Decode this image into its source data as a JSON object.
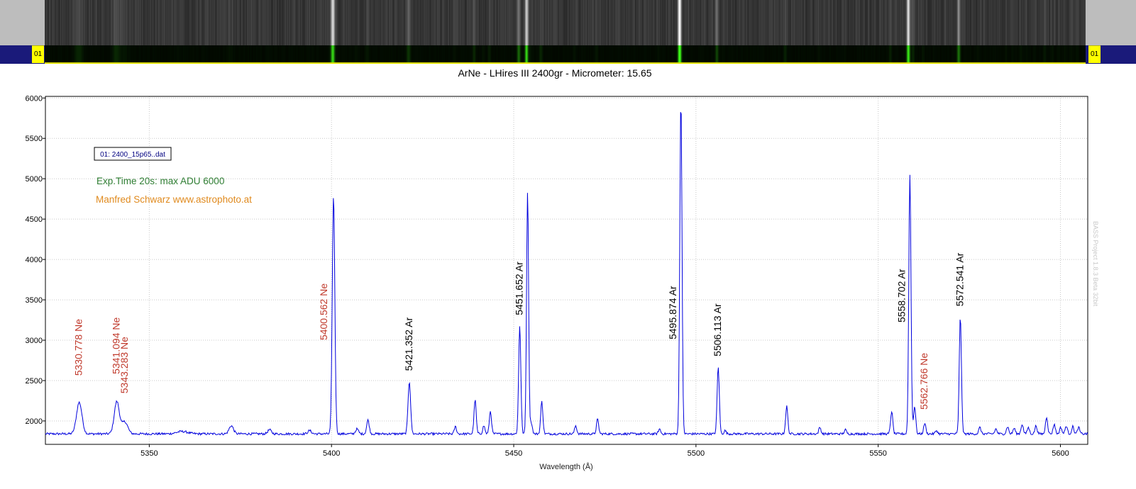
{
  "strip": {
    "left_tag": "01",
    "right_tag": "01"
  },
  "chart_data": {
    "type": "line",
    "title": "ArNe - LHires III 2400gr - Micrometer: 15.65",
    "xlabel": "Wavelength (Å)",
    "ylabel": "",
    "xlim": [
      5321.5,
      5607.5
    ],
    "ylim": [
      1710,
      6020
    ],
    "xticks": [
      5350,
      5400,
      5450,
      5500,
      5550,
      5600
    ],
    "yticks": [
      2000,
      2500,
      3000,
      3500,
      4000,
      4500,
      5000,
      5500,
      6000
    ],
    "grid": true,
    "baseline": 1840,
    "legend": {
      "label": "01: 2400_15p65..dat",
      "position": "top-left"
    },
    "notes": [
      {
        "text": "Exp.Time 20s: max ADU 6000",
        "color": "#2e7d32"
      },
      {
        "text": "Manfred Schwarz www.astrophoto.at",
        "color": "#e08a1e"
      }
    ],
    "watermark": "BASS Project 1.8.3 Beta 32bit",
    "line_color": "#0000dd",
    "peaks": [
      [
        5330.78,
        2230,
        0.75
      ],
      [
        5341.09,
        2240,
        0.7
      ],
      [
        5343.28,
        1990,
        0.8
      ],
      [
        5359.0,
        1870,
        1.5
      ],
      [
        5372.5,
        1940,
        0.6
      ],
      [
        5383.0,
        1890,
        0.5
      ],
      [
        5394.0,
        1880,
        0.5
      ],
      [
        5400.56,
        4790,
        0.35
      ],
      [
        5407.0,
        1900,
        0.4
      ],
      [
        5410.0,
        2010,
        0.35
      ],
      [
        5421.35,
        2490,
        0.35
      ],
      [
        5434.0,
        1930,
        0.3
      ],
      [
        5439.4,
        2260,
        0.3
      ],
      [
        5441.8,
        1940,
        0.3
      ],
      [
        5443.6,
        2120,
        0.3
      ],
      [
        5451.65,
        3180,
        0.3
      ],
      [
        5453.8,
        4850,
        0.28
      ],
      [
        5454.8,
        1980,
        0.3
      ],
      [
        5457.7,
        2240,
        0.3
      ],
      [
        5467.0,
        1940,
        0.3
      ],
      [
        5473.0,
        2020,
        0.3
      ],
      [
        5490.0,
        1900,
        0.3
      ],
      [
        5495.87,
        6000,
        0.3
      ],
      [
        5506.11,
        2670,
        0.3
      ],
      [
        5508.0,
        1880,
        0.3
      ],
      [
        5524.9,
        2180,
        0.3
      ],
      [
        5534.0,
        1920,
        0.3
      ],
      [
        5541.0,
        1890,
        0.3
      ],
      [
        5553.7,
        2120,
        0.3
      ],
      [
        5558.7,
        5050,
        0.3
      ],
      [
        5560.0,
        2180,
        0.3
      ],
      [
        5562.77,
        1970,
        0.3
      ],
      [
        5566.0,
        1880,
        0.3
      ],
      [
        5572.54,
        3290,
        0.3
      ],
      [
        5577.9,
        1920,
        0.3
      ],
      [
        5582.3,
        1900,
        0.3
      ],
      [
        5585.5,
        1930,
        0.3
      ],
      [
        5587.3,
        1910,
        0.3
      ],
      [
        5589.5,
        1960,
        0.3
      ],
      [
        5591.2,
        1920,
        0.3
      ],
      [
        5593.3,
        1940,
        0.3
      ],
      [
        5596.2,
        2050,
        0.3
      ],
      [
        5598.3,
        1960,
        0.3
      ],
      [
        5600.1,
        1920,
        0.3
      ],
      [
        5601.6,
        1940,
        0.3
      ],
      [
        5603.4,
        1930,
        0.3
      ],
      [
        5605.0,
        1920,
        0.3
      ]
    ],
    "annotations": [
      {
        "text": "5330.778 Ne",
        "x": 5330.778,
        "y": 2560,
        "color": "#c0392b"
      },
      {
        "text": "5341.094 Ne",
        "x": 5341.094,
        "y": 2580,
        "color": "#c0392b"
      },
      {
        "text": "5343.283 Ne",
        "x": 5343.283,
        "y": 2340,
        "color": "#c0392b"
      },
      {
        "text": "5400.562 Ne",
        "x": 5398.0,
        "y": 3000,
        "color": "#c0392b"
      },
      {
        "text": "5421.352 Ar",
        "x": 5421.352,
        "y": 2620,
        "color": "#000000"
      },
      {
        "text": "5451.652 Ar",
        "x": 5451.652,
        "y": 3310,
        "color": "#000000"
      },
      {
        "text": "5495.874 Ar",
        "x": 5493.8,
        "y": 3010,
        "color": "#000000"
      },
      {
        "text": "5506.113 Ar",
        "x": 5506.113,
        "y": 2800,
        "color": "#000000"
      },
      {
        "text": "5558.702 Ar",
        "x": 5556.6,
        "y": 3220,
        "color": "#000000"
      },
      {
        "text": "5562.766 Ne",
        "x": 5562.766,
        "y": 2140,
        "color": "#c0392b"
      },
      {
        "text": "5572.541 Ar",
        "x": 5572.541,
        "y": 3420,
        "color": "#000000"
      }
    ]
  }
}
